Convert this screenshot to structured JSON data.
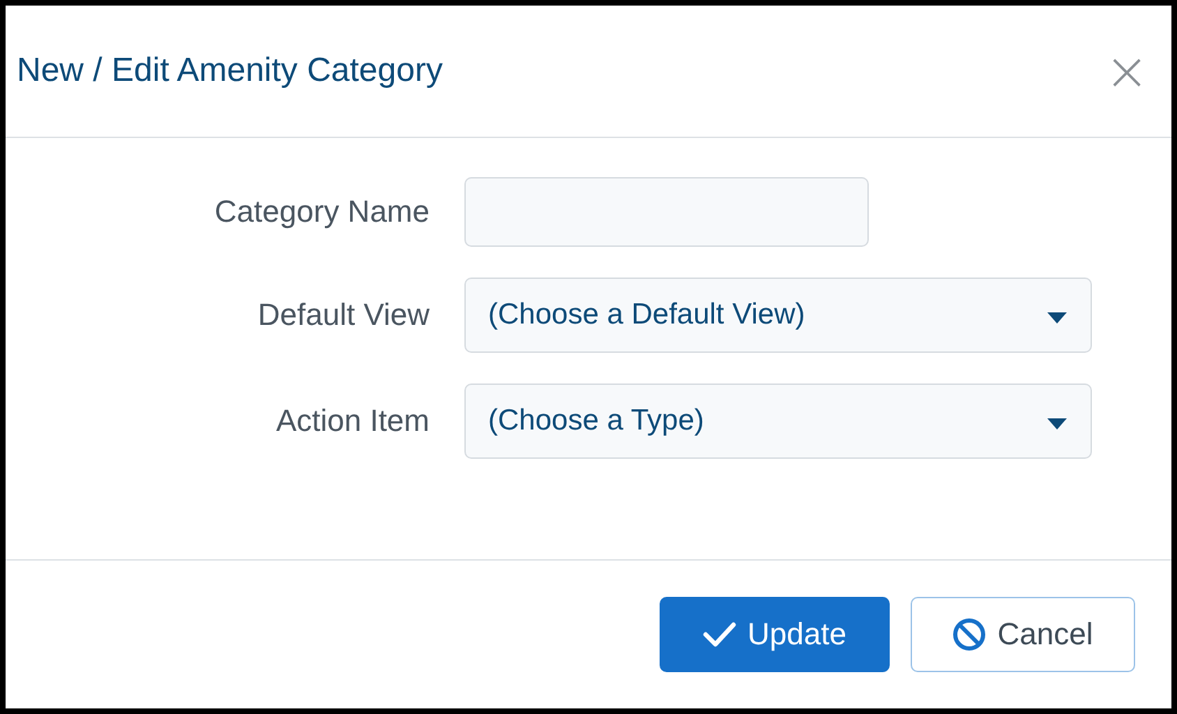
{
  "dialog": {
    "title": "New / Edit Amenity Category",
    "close": "×"
  },
  "fields": [
    {
      "kind": "text",
      "label": "Category Name"
    },
    {
      "kind": "select",
      "label": "Default View",
      "value": "(Choose a Default View)"
    },
    {
      "kind": "select",
      "label": "Action Item",
      "value": "(Choose a Type)"
    }
  ],
  "buttons": [
    {
      "kind": "primary",
      "label": "Update"
    },
    {
      "kind": "secondary",
      "label": "Cancel"
    }
  ]
}
